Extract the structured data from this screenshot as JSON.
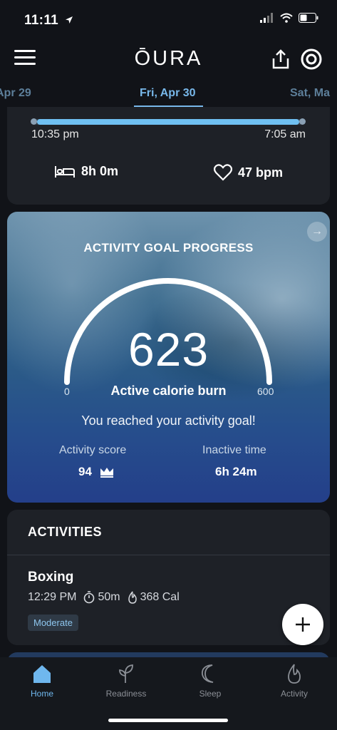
{
  "status_bar": {
    "time": "11:11"
  },
  "header": {
    "logo": "ŌURA"
  },
  "dates": {
    "prev": "Apr 29",
    "current": "Fri, Apr 30",
    "next": "Sat, Ma"
  },
  "sleep": {
    "start": "10:35 pm",
    "end": "7:05 am",
    "duration": "8h 0m",
    "heart_rate": "47 bpm"
  },
  "activity_goal": {
    "title": "ACTIVITY GOAL PROGRESS",
    "value": "623",
    "gauge_min": "0",
    "gauge_max": "600",
    "label": "Active calorie burn",
    "message": "You reached your activity goal!",
    "score_label": "Activity score",
    "score": "94",
    "inactive_label": "Inactive time",
    "inactive": "6h 24m"
  },
  "activities": {
    "heading": "ACTIVITIES",
    "items": [
      {
        "name": "Boxing",
        "time": "12:29 PM",
        "duration": "50m",
        "calories": "368 Cal",
        "intensity": "Moderate"
      }
    ]
  },
  "tabs": [
    {
      "label": "Home",
      "icon": "home-icon"
    },
    {
      "label": "Readiness",
      "icon": "sprout-icon"
    },
    {
      "label": "Sleep",
      "icon": "moon-icon"
    },
    {
      "label": "Activity",
      "icon": "flame-icon"
    }
  ],
  "colors": {
    "accent": "#6fb7ee",
    "background": "#111318",
    "card": "#1e2127"
  }
}
